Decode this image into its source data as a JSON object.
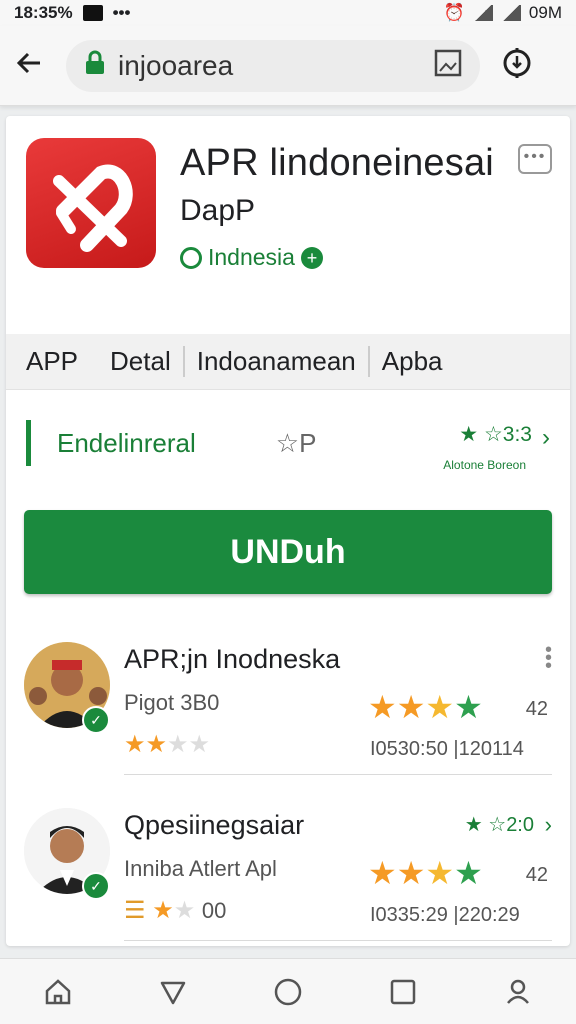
{
  "status": {
    "time": "18:35%",
    "dots": "•••",
    "right_text": "09M"
  },
  "browser": {
    "url": "injooarea"
  },
  "app": {
    "title": "APR lindoneinesai",
    "developer": "DapP",
    "country": "Indnesia",
    "more_label": "•••"
  },
  "tabs": [
    {
      "label": "APP"
    },
    {
      "label": "Detal"
    },
    {
      "label": "Indoanamean"
    },
    {
      "label": "Apba"
    }
  ],
  "meta": {
    "label": "Endelinreral",
    "star_text": "P",
    "rating": "3:3",
    "sub_text": "Alotone Boreon"
  },
  "install": {
    "label": "UNDuh"
  },
  "reviews": [
    {
      "name": "APR;jn Inodneska",
      "subtitle": "Pigot 3B0",
      "count": "42",
      "date": "I0530:50 |120114",
      "small_rating": 2.5,
      "big_rating": 3.5
    },
    {
      "name": "Qpesiinegsaiar",
      "subtitle": "Inniba Atlert Apl",
      "small_text": "00",
      "count": "42",
      "date": "I0335:29 |220:29",
      "rating": "2:0",
      "small_rating": 1.5,
      "big_rating": 3.5
    }
  ],
  "colors": {
    "accent_green": "#1b8a3e",
    "icon_red": "#e53935",
    "star_orange": "#f59a25"
  }
}
